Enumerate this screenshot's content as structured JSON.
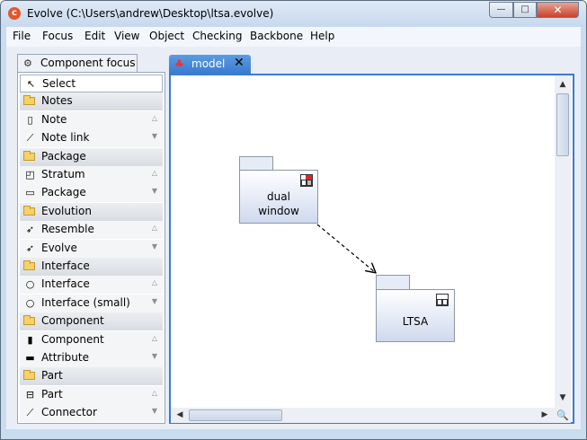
{
  "window": {
    "title": "Evolve (C:\\Users\\andrew\\Desktop\\ltsa.evolve)",
    "app_icon_glyph": "c",
    "controls": {
      "minimize": "—",
      "maximize": "□",
      "close": "✕"
    }
  },
  "menu": [
    "File",
    "Focus",
    "Edit",
    "View",
    "Object",
    "Checking",
    "Backbone",
    "Help"
  ],
  "palette": {
    "tab_label": "Component focus",
    "rows": [
      {
        "type": "select",
        "label": "Select",
        "icon": "arrow-cursor-icon",
        "glyph": "↖"
      },
      {
        "type": "header",
        "label": "Notes"
      },
      {
        "type": "tool",
        "label": "Note",
        "icon": "note-icon",
        "glyph": "▯",
        "arrow": "△"
      },
      {
        "type": "tool",
        "label": "Note link",
        "icon": "note-link-icon",
        "glyph": "⟋",
        "arrow": "▼"
      },
      {
        "type": "header",
        "label": "Package"
      },
      {
        "type": "tool",
        "label": "Stratum",
        "icon": "stratum-icon",
        "glyph": "◰",
        "arrow": "△"
      },
      {
        "type": "tool",
        "label": "Package",
        "icon": "package-icon",
        "glyph": "▭",
        "arrow": "▼"
      },
      {
        "type": "header",
        "label": "Evolution"
      },
      {
        "type": "tool",
        "label": "Resemble",
        "icon": "resemble-icon",
        "glyph": "➶",
        "arrow": "△"
      },
      {
        "type": "tool",
        "label": "Evolve",
        "icon": "evolve-icon",
        "glyph": "➶",
        "arrow": "▼"
      },
      {
        "type": "header",
        "label": "Interface"
      },
      {
        "type": "tool",
        "label": "Interface",
        "icon": "interface-icon",
        "glyph": "○",
        "arrow": "△"
      },
      {
        "type": "tool",
        "label": "Interface (small)",
        "icon": "interface-small-icon",
        "glyph": "○",
        "arrow": "▼"
      },
      {
        "type": "header",
        "label": "Component"
      },
      {
        "type": "tool",
        "label": "Component",
        "icon": "component-icon",
        "glyph": "▮",
        "arrow": "△"
      },
      {
        "type": "tool",
        "label": "Attribute",
        "icon": "attribute-icon",
        "glyph": "▬",
        "arrow": "▼"
      },
      {
        "type": "header",
        "label": "Part"
      },
      {
        "type": "tool",
        "label": "Part",
        "icon": "part-icon",
        "glyph": "⊟",
        "arrow": "△"
      },
      {
        "type": "tool",
        "label": "Connector",
        "icon": "connector-icon",
        "glyph": "⟋",
        "arrow": "▼"
      }
    ]
  },
  "editor": {
    "tab_label": "model",
    "tab_icon": "model-tree-icon",
    "tab_icon_glyph": "♣",
    "tab_close": "✕"
  },
  "diagram": {
    "packages": [
      {
        "name": "dual\nwindow",
        "stereotype_color": "#d9282f"
      },
      {
        "name": "LTSA",
        "stereotype_color": "#ffffff"
      }
    ]
  },
  "scrollbars": {
    "up": "▲",
    "down": "▼",
    "left": "◀",
    "right": "▶",
    "zoom": "🔍"
  },
  "colors": {
    "accent": "#3a7bd0",
    "package_fill": "#cfd9ee",
    "stereotype_red": "#d9282f"
  }
}
